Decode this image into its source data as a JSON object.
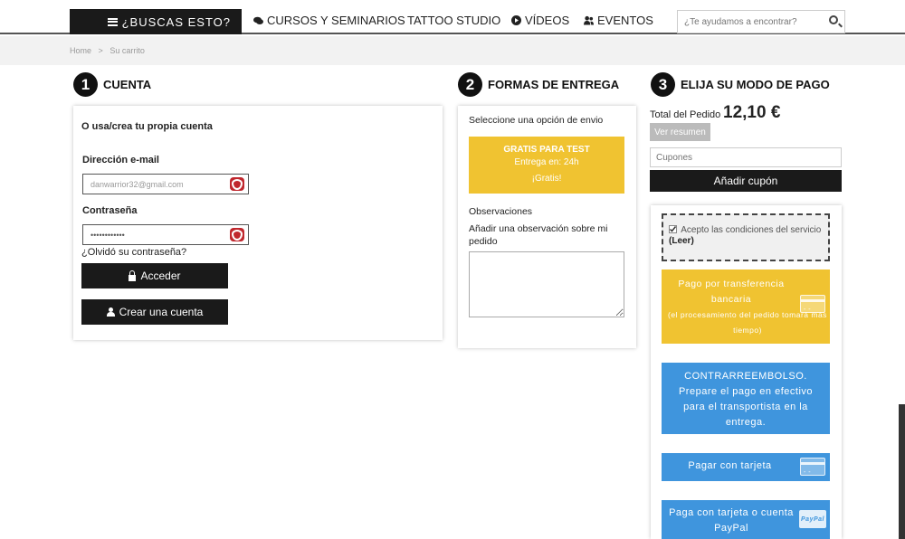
{
  "header": {
    "menu_label": "¿BUSCAS ESTO?",
    "nav": [
      {
        "label": "CURSOS Y SEMINARIOS",
        "icon": "comments-icon"
      },
      {
        "label": "TATTOO STUDIO",
        "icon": ""
      },
      {
        "label": "VÍDEOS",
        "icon": "play-icon"
      },
      {
        "label": "EVENTOS",
        "icon": "users-icon"
      }
    ],
    "search_placeholder": "¿Te ayudamos a encontrar?"
  },
  "breadcrumb": {
    "home": "Home",
    "sep": ">",
    "current": "Su carrito"
  },
  "account": {
    "step_num": "1",
    "title": "CUENTA",
    "subtitle": "O usa/crea tu propia cuenta",
    "email_label": "Dirección e-mail",
    "email_value": "danwarrior32@gmail.com",
    "password_label": "Contraseña",
    "password_value": "••••••••••••",
    "forgot": "¿Olvidó su contraseña?",
    "login_button": "Acceder",
    "create_button": "Crear una cuenta"
  },
  "delivery": {
    "step_num": "2",
    "title": "FORMAS DE ENTREGA",
    "prompt": "Seleccione una opción de envio",
    "option_title": "GRATIS PARA TEST",
    "option_eta": "Entrega en:  24h",
    "option_price": "¡Gratis!",
    "observations_label": "Observaciones",
    "observations_hint": "Añadir una observación sobre mi pedido"
  },
  "payment": {
    "step_num": "3",
    "title": "ELIJA SU MODO DE PAGO",
    "total_label": "Total del Pedido",
    "total_value": "12,10 €",
    "summary_button": "Ver resumen",
    "coupon_placeholder": "Cupones",
    "coupon_button": "Añadir cupón",
    "terms_text": "Acepto las condiciones del servicio",
    "terms_link": "(Leer)",
    "transfer_title": "Pago por transferencia bancaria",
    "transfer_note": "(el procesamiento del pedido tomará más tiempo)",
    "cod_text": "CONTRARREEMBOLSO. Prepare el pago en efectivo para el transportista en la entrega.",
    "card_text": "Pagar con tarjeta",
    "paypal_text": "Paga con tarjeta o cuenta PayPal",
    "paypal_logo": "PayPal"
  },
  "colors": {
    "yellow": "#f0c331",
    "blue": "#3f95dd",
    "dark": "#1a1a1a"
  }
}
